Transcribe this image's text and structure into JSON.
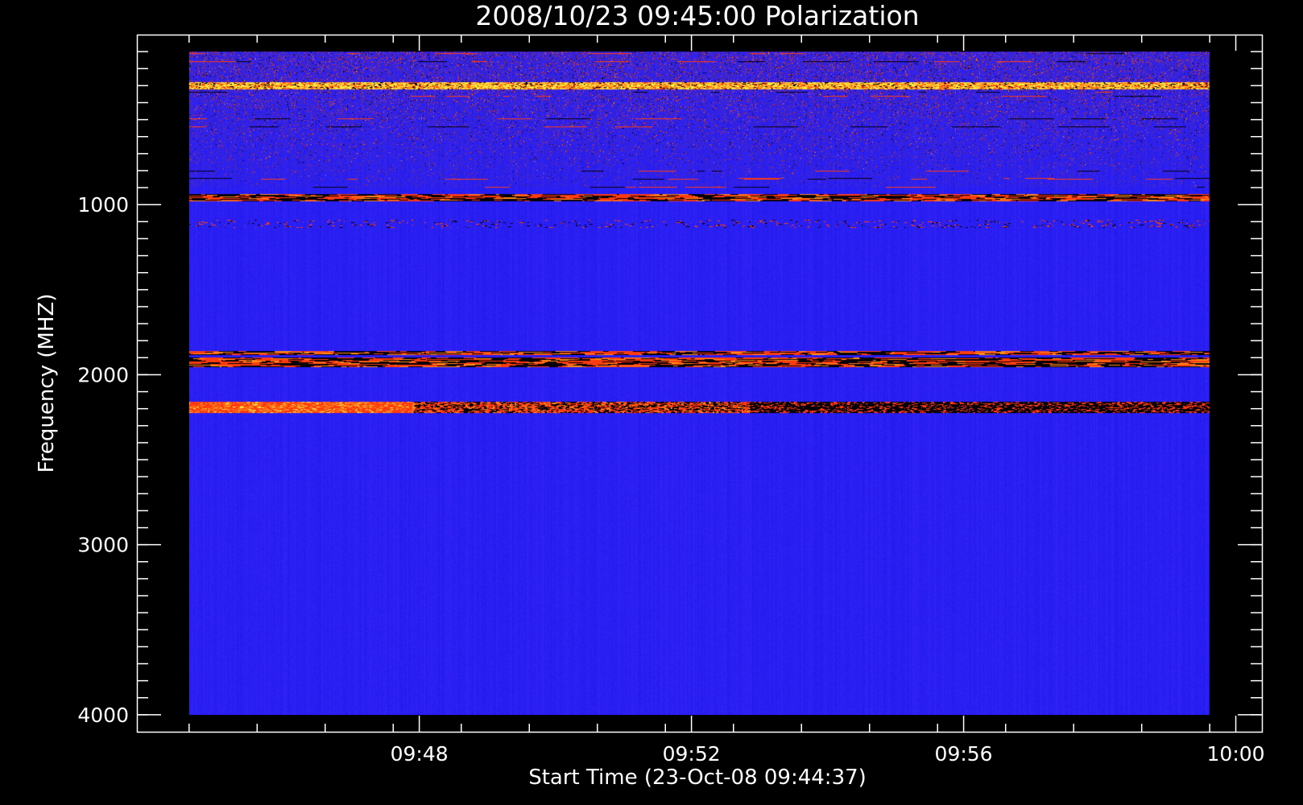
{
  "chart_data": {
    "type": "heatmap",
    "title": "2008/10/23 09:45:00 Polarization",
    "xlabel": "Start Time (23-Oct-08 09:44:37)",
    "ylabel": "Frequency (MHZ)",
    "x_ticks": [
      {
        "minutes": 3.383,
        "label": "09:48"
      },
      {
        "minutes": 7.383,
        "label": "09:52"
      },
      {
        "minutes": 11.383,
        "label": "09:56"
      },
      {
        "minutes": 15.383,
        "label": "10:00"
      }
    ],
    "y_ticks": [
      {
        "value": 1000,
        "label": "1000"
      },
      {
        "value": 2000,
        "label": "2000"
      },
      {
        "value": 3000,
        "label": "3000"
      },
      {
        "value": 4000,
        "label": "4000"
      }
    ],
    "x_minor_step_minutes": 1,
    "y_minor_step_mhz": 100,
    "axis_x_range_minutes": [
      -0.767,
      15.767
    ],
    "axis_y_range_mhz": [
      0,
      4100
    ],
    "data_x_range_minutes": [
      0,
      15
    ],
    "data_y_range_mhz": [
      100,
      4000
    ],
    "colors": {
      "background": "#000000",
      "field": "#2a1ff2",
      "noise_band": "#4b2ab8",
      "red": "#ff3b10",
      "orange": "#ff8c1a",
      "yellow": "#ffe840",
      "dark": "#050008"
    },
    "bands": [
      {
        "from_mhz": 100,
        "to_mhz": 900,
        "kind": "noisy"
      },
      {
        "from_mhz": 280,
        "to_mhz": 320,
        "kind": "bright-yellow"
      },
      {
        "from_mhz": 940,
        "to_mhz": 975,
        "kind": "red-black-alternating"
      },
      {
        "from_mhz": 1090,
        "to_mhz": 1130,
        "kind": "speckled"
      },
      {
        "from_mhz": 1860,
        "to_mhz": 1880,
        "kind": "red-black-alternating"
      },
      {
        "from_mhz": 1900,
        "to_mhz": 1950,
        "kind": "red-black-alternating"
      },
      {
        "from_mhz": 2160,
        "to_mhz": 2220,
        "kind": "strong-red-then-dark"
      }
    ]
  }
}
